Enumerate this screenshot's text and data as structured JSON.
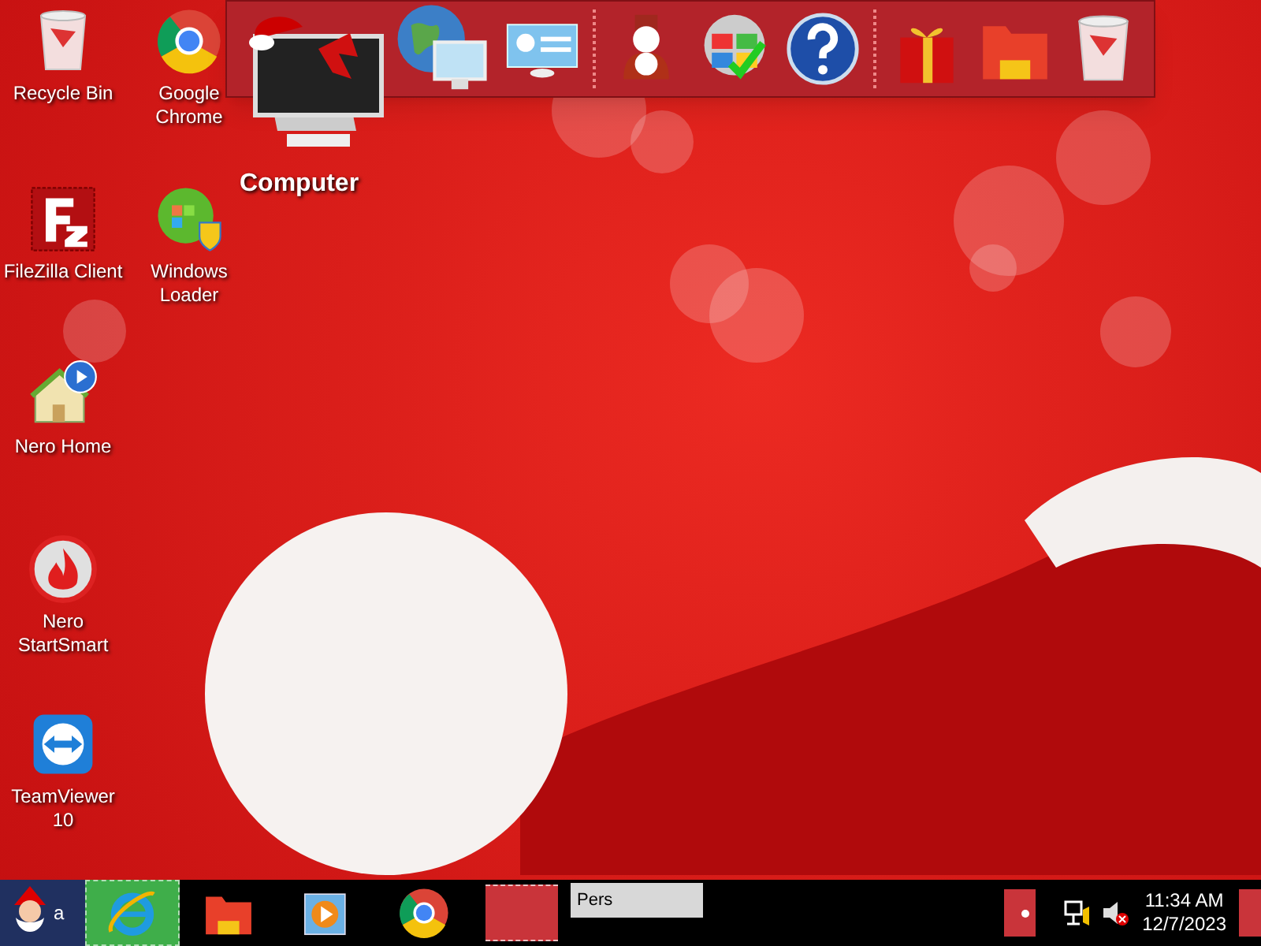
{
  "desktop_icons": [
    {
      "kind": "recycle",
      "label": "Recycle Bin"
    },
    {
      "kind": "chrome",
      "label": "Google Chrome"
    },
    {
      "kind": "filezilla",
      "label": "FileZilla Client"
    },
    {
      "kind": "loader",
      "label": "Windows Loader"
    },
    {
      "kind": "nero-home",
      "label": "Nero Home"
    },
    {
      "kind": "nero-smart",
      "label": "Nero StartSmart"
    },
    {
      "kind": "teamviewer",
      "label": "TeamViewer 10"
    }
  ],
  "dock": {
    "items": [
      {
        "kind": "computer",
        "label": "Computer"
      },
      {
        "kind": "network"
      },
      {
        "kind": "panel"
      },
      {
        "kind": "separator"
      },
      {
        "kind": "snowman"
      },
      {
        "kind": "flag"
      },
      {
        "kind": "help"
      },
      {
        "kind": "separator"
      },
      {
        "kind": "gift"
      },
      {
        "kind": "folder"
      },
      {
        "kind": "recycle"
      }
    ]
  },
  "taskbar": {
    "start_label": "a",
    "items": [
      {
        "kind": "ie",
        "selected": true
      },
      {
        "kind": "folder",
        "selected": false
      },
      {
        "kind": "media",
        "selected": false
      },
      {
        "kind": "chrome",
        "selected": false
      },
      {
        "kind": "blank",
        "selected": false
      }
    ],
    "preview_text": "Pers",
    "time": "11:34 AM",
    "date": "12/7/2023"
  }
}
